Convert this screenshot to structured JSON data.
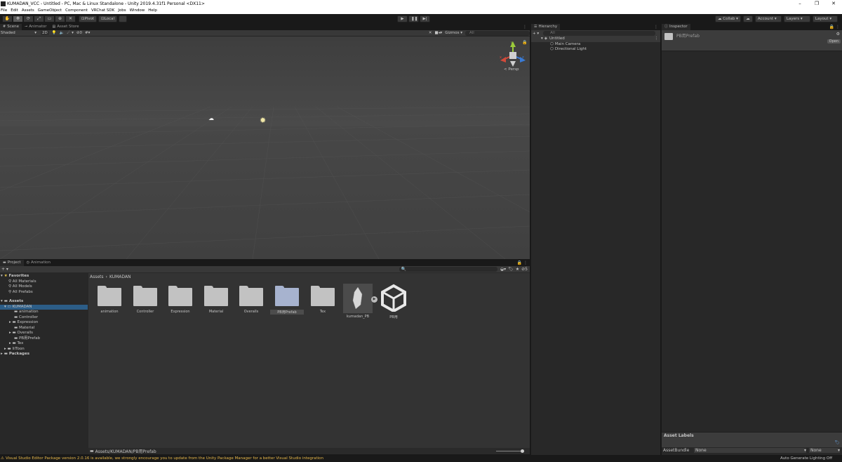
{
  "window": {
    "title": "KUMADAN_VCC - Untitled - PC, Mac & Linux Standalone - Unity 2019.4.31f1 Personal <DX11>",
    "minimize": "–",
    "maximize": "❐",
    "close": "✕"
  },
  "menu": [
    "File",
    "Edit",
    "Assets",
    "GameObject",
    "Component",
    "VRChat SDK",
    "Jobs",
    "Window",
    "Help"
  ],
  "toolbar": {
    "pivot": "Pivot",
    "local": "Local",
    "collab": "Collab ▾",
    "account": "Account",
    "layers": "Layers",
    "layout": "Layout"
  },
  "scene": {
    "tabs": [
      "Scene",
      "Animator",
      "Asset Store"
    ],
    "shading": "Shaded",
    "mode_2d": "2D",
    "gizmos": "Gizmos",
    "search_placeholder": "All",
    "persp_label": "< Persp",
    "gizmo_axes": {
      "x": "x",
      "y": "y",
      "z": "z"
    }
  },
  "hierarchy": {
    "tab": "Hierarchy",
    "search_placeholder": "All",
    "scene_name": "Untitled",
    "items": [
      "Main Camera",
      "Directional Light"
    ]
  },
  "inspector": {
    "tab": "Inspector",
    "asset_name": "PB用Prefab",
    "open_button": "Open",
    "asset_labels": "Asset Labels",
    "asset_bundle_label": "AssetBundle",
    "asset_bundle_value": "None",
    "asset_variant_value": "None"
  },
  "project": {
    "tabs": [
      "Project",
      "Animation"
    ],
    "counter": "5",
    "breadcrumb": [
      "Assets",
      "KUMADAN"
    ],
    "tree": {
      "favorites": "Favorites",
      "favorite_items": [
        "All Materials",
        "All Models",
        "All Prefabs"
      ],
      "assets": "Assets",
      "kumadan": "KUMADAN",
      "kumadan_children": [
        "animation",
        "Controller",
        "Expression",
        "Material",
        "Overalls",
        "PB用Prefab",
        "Tex"
      ],
      "liltoon": "lilToon",
      "packages": "Packages"
    },
    "grid_items": [
      "animation",
      "Controller",
      "Expression",
      "Material",
      "Overalls",
      "PB用Prefab",
      "Tex",
      "kumadan_PB",
      "PB用"
    ],
    "selected_path": "Assets/KUMADAN/PB用Prefab"
  },
  "status": {
    "warning": "Visual Studio Editor Package version 2.0.16 is available, we strongly encourage you to update from the Unity Package Manager for a better Visual Studio integration",
    "lighting": "Auto Generate Lighting Off"
  },
  "colors": {
    "selection": "#2c5d87",
    "warning_text": "#e8b84a",
    "gizmo_x": "#d24a3a",
    "gizmo_y": "#9ccc3a",
    "gizmo_z": "#3a7bd5"
  }
}
